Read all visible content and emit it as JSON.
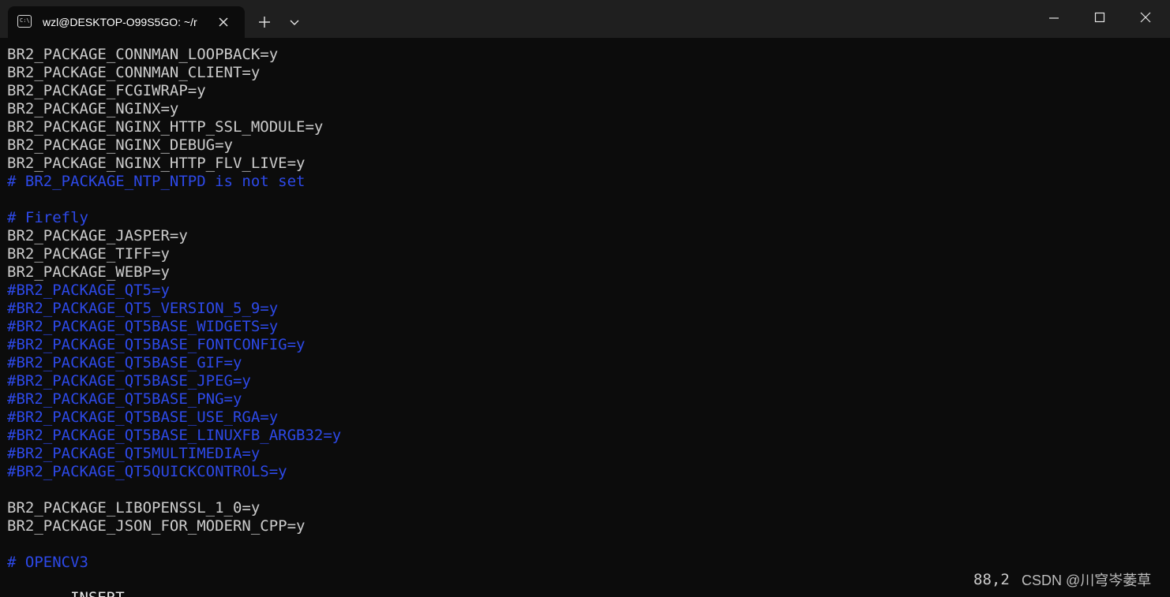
{
  "window": {
    "tab_title": "wzl@DESKTOP-O99S5GO: ~/r",
    "icons": {
      "tab": "terminal-icon",
      "tab_close": "close-icon",
      "new_tab": "plus-icon",
      "dropdown": "chevron-down-icon",
      "minimize": "minimize-icon",
      "maximize": "maximize-icon",
      "close": "close-icon"
    }
  },
  "colors": {
    "background": "#0c0c0c",
    "titlebar": "#1f1f1f",
    "text": "#cccccc",
    "comment": "#2d49e8"
  },
  "terminal": {
    "lines": [
      {
        "text": "BR2_PACKAGE_CONNMAN_LOOPBACK=y",
        "kind": "default"
      },
      {
        "text": "BR2_PACKAGE_CONNMAN_CLIENT=y",
        "kind": "default"
      },
      {
        "text": "BR2_PACKAGE_FCGIWRAP=y",
        "kind": "default"
      },
      {
        "text": "BR2_PACKAGE_NGINX=y",
        "kind": "default"
      },
      {
        "text": "BR2_PACKAGE_NGINX_HTTP_SSL_MODULE=y",
        "kind": "default"
      },
      {
        "text": "BR2_PACKAGE_NGINX_DEBUG=y",
        "kind": "default"
      },
      {
        "text": "BR2_PACKAGE_NGINX_HTTP_FLV_LIVE=y",
        "kind": "default"
      },
      {
        "text": "# BR2_PACKAGE_NTP_NTPD is not set",
        "kind": "comment"
      },
      {
        "text": "",
        "kind": "default"
      },
      {
        "text": "# Firefly",
        "kind": "comment"
      },
      {
        "text": "BR2_PACKAGE_JASPER=y",
        "kind": "default"
      },
      {
        "text": "BR2_PACKAGE_TIFF=y",
        "kind": "default"
      },
      {
        "text": "BR2_PACKAGE_WEBP=y",
        "kind": "default"
      },
      {
        "text": "#BR2_PACKAGE_QT5=y",
        "kind": "comment"
      },
      {
        "text": "#BR2_PACKAGE_QT5_VERSION_5_9=y",
        "kind": "comment"
      },
      {
        "text": "#BR2_PACKAGE_QT5BASE_WIDGETS=y",
        "kind": "comment"
      },
      {
        "text": "#BR2_PACKAGE_QT5BASE_FONTCONFIG=y",
        "kind": "comment"
      },
      {
        "text": "#BR2_PACKAGE_QT5BASE_GIF=y",
        "kind": "comment"
      },
      {
        "text": "#BR2_PACKAGE_QT5BASE_JPEG=y",
        "kind": "comment"
      },
      {
        "text": "#BR2_PACKAGE_QT5BASE_PNG=y",
        "kind": "comment"
      },
      {
        "text": "#BR2_PACKAGE_QT5BASE_USE_RGA=y",
        "kind": "comment"
      },
      {
        "text": "#BR2_PACKAGE_QT5BASE_LINUXFB_ARGB32=y",
        "kind": "comment"
      },
      {
        "text": "#BR2_PACKAGE_QT5MULTIMEDIA=y",
        "kind": "comment"
      },
      {
        "text": "#BR2_PACKAGE_QT5QUICKCONTROLS=y",
        "kind": "comment"
      },
      {
        "text": "",
        "kind": "default"
      },
      {
        "text": "BR2_PACKAGE_LIBOPENSSL_1_0=y",
        "kind": "default"
      },
      {
        "text": "BR2_PACKAGE_JSON_FOR_MODERN_CPP=y",
        "kind": "default"
      },
      {
        "text": "",
        "kind": "default"
      },
      {
        "text": "# OPENCV3",
        "kind": "comment"
      }
    ]
  },
  "status": {
    "mode": "-- INSERT --",
    "cursor": "88,2",
    "watermark": "CSDN @川穹岑萎草"
  }
}
